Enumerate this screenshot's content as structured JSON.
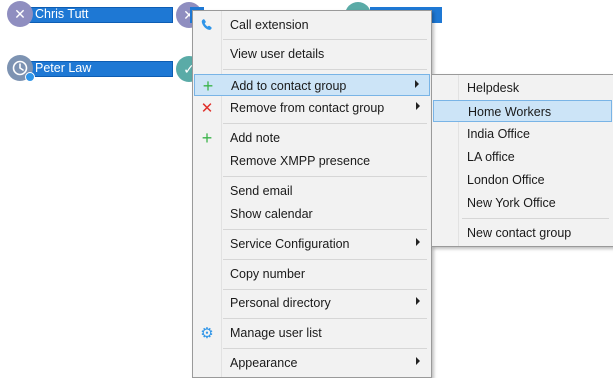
{
  "contacts": [
    {
      "name": "Chris Tutt",
      "status": "x"
    },
    {
      "name": "Peter Law",
      "status": "clock"
    }
  ],
  "context_menu": {
    "items": [
      {
        "label": "Call extension",
        "icon": "phone-icon"
      },
      {
        "label": "View user details"
      },
      {
        "label": "Add to contact group",
        "icon": "plus-icon",
        "submenu": true,
        "highlighted": true
      },
      {
        "label": "Remove from contact group",
        "icon": "x-icon",
        "submenu": true
      },
      {
        "label": "Add note",
        "icon": "plus-icon"
      },
      {
        "label": "Remove XMPP presence"
      },
      {
        "label": "Send email"
      },
      {
        "label": "Show calendar"
      },
      {
        "label": "Service Configuration",
        "submenu": true
      },
      {
        "label": "Copy number"
      },
      {
        "label": "Personal directory",
        "submenu": true
      },
      {
        "label": "Manage user list",
        "icon": "gear-icon"
      },
      {
        "label": "Appearance",
        "submenu": true
      }
    ]
  },
  "group_submenu": {
    "items": [
      {
        "label": "Helpdesk"
      },
      {
        "label": "Home Workers",
        "highlighted": true
      },
      {
        "label": "India Office"
      },
      {
        "label": "LA office"
      },
      {
        "label": "London Office"
      },
      {
        "label": "New York Office"
      },
      {
        "label": "New contact group"
      }
    ]
  },
  "colors": {
    "selection": "#1e78d4",
    "menu_highlight": "#cce4f7",
    "plus": "#3cb44b",
    "x": "#e0312b",
    "accent": "#2f95e8"
  }
}
